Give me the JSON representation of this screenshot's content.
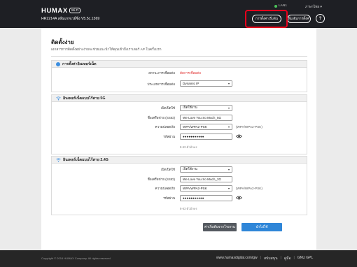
{
  "header": {
    "logo": "HUMAX",
    "logo_badge": "Wi-Fi",
    "model": "HR2214A สลิมเกทเวย์ซิ่ง  V5.5c.1369",
    "lan_label": "LAN1",
    "language": "ภาษาไทย",
    "setup_button": "การตั้งค่าเริ่มต้น",
    "advanced_button": "เพิ่มเติมการตั้งค่า",
    "help_button": "?"
  },
  "page": {
    "title": "ติดตั้งง่าย",
    "description": "เอกสารการติดตั้งอย่างง่ายจะช่วยแนะนำให้คุณเข้าถึงเราเตอร์ AP ในครั้งแรก"
  },
  "wan": {
    "heading": "การตั้งค่าอินเทอร์เน็ต",
    "status_label": "สถานะการเชื่อมต่อ",
    "status_value": "ตัดการเชื่อมต่อ",
    "type_label": "ประเภทการเชื่อมต่อ",
    "type_value": "Dynamic IP"
  },
  "wifi5": {
    "heading": "อินเทอร์เน็ตแบบไร้สาย 5G",
    "enable_label": "เปิด/ปิดใช้",
    "enable_value": "เปิดใช้งาน",
    "ssid_label": "ชื่อเครือข่าย (SSID)",
    "ssid_value": "We Love You So Much_5G",
    "security_label": "ความปลอดภัย",
    "security_value": "WPA/WPA2-PSK",
    "security_hint": "(WPA/WPA2-PSK)",
    "password_label": "รหัสผ่าน",
    "password_value": "●●●●●●●●●●●",
    "password_hint": "8-63 ตัวอักษร"
  },
  "wifi24": {
    "heading": "อินเทอร์เน็ตแบบไร้สาย 2.4G",
    "enable_label": "เปิด/ปิดใช้",
    "enable_value": "เปิดใช้งาน",
    "ssid_label": "ชื่อเครือข่าย (SSID)",
    "ssid_value": "We Love You So Much_2G",
    "security_label": "ความปลอดภัย",
    "security_value": "WPA/WPA2-PSK",
    "security_hint": "(WPA/WPA2-PSK)",
    "password_label": "รหัสผ่าน",
    "password_value": "●●●●●●●●●●●",
    "password_hint": "8-63 ตัวอักษร"
  },
  "actions": {
    "cancel": "ค่าเริ่มต้นจากโรงงาน",
    "apply": "นำไปใช้"
  },
  "footer": {
    "copyright": "Copyright © 2016 HUMAX Company. All rights reserved.",
    "site": "www.humaxdigital.com/gw",
    "support": "สนับสนุน",
    "manual": "คู่มือ",
    "gpl": "GNU GPL"
  },
  "colors": {
    "header_bg": "#1e1f24",
    "accent_blue": "#2f86d8",
    "highlight_red": "#e8001c",
    "error_red": "#e03030"
  }
}
